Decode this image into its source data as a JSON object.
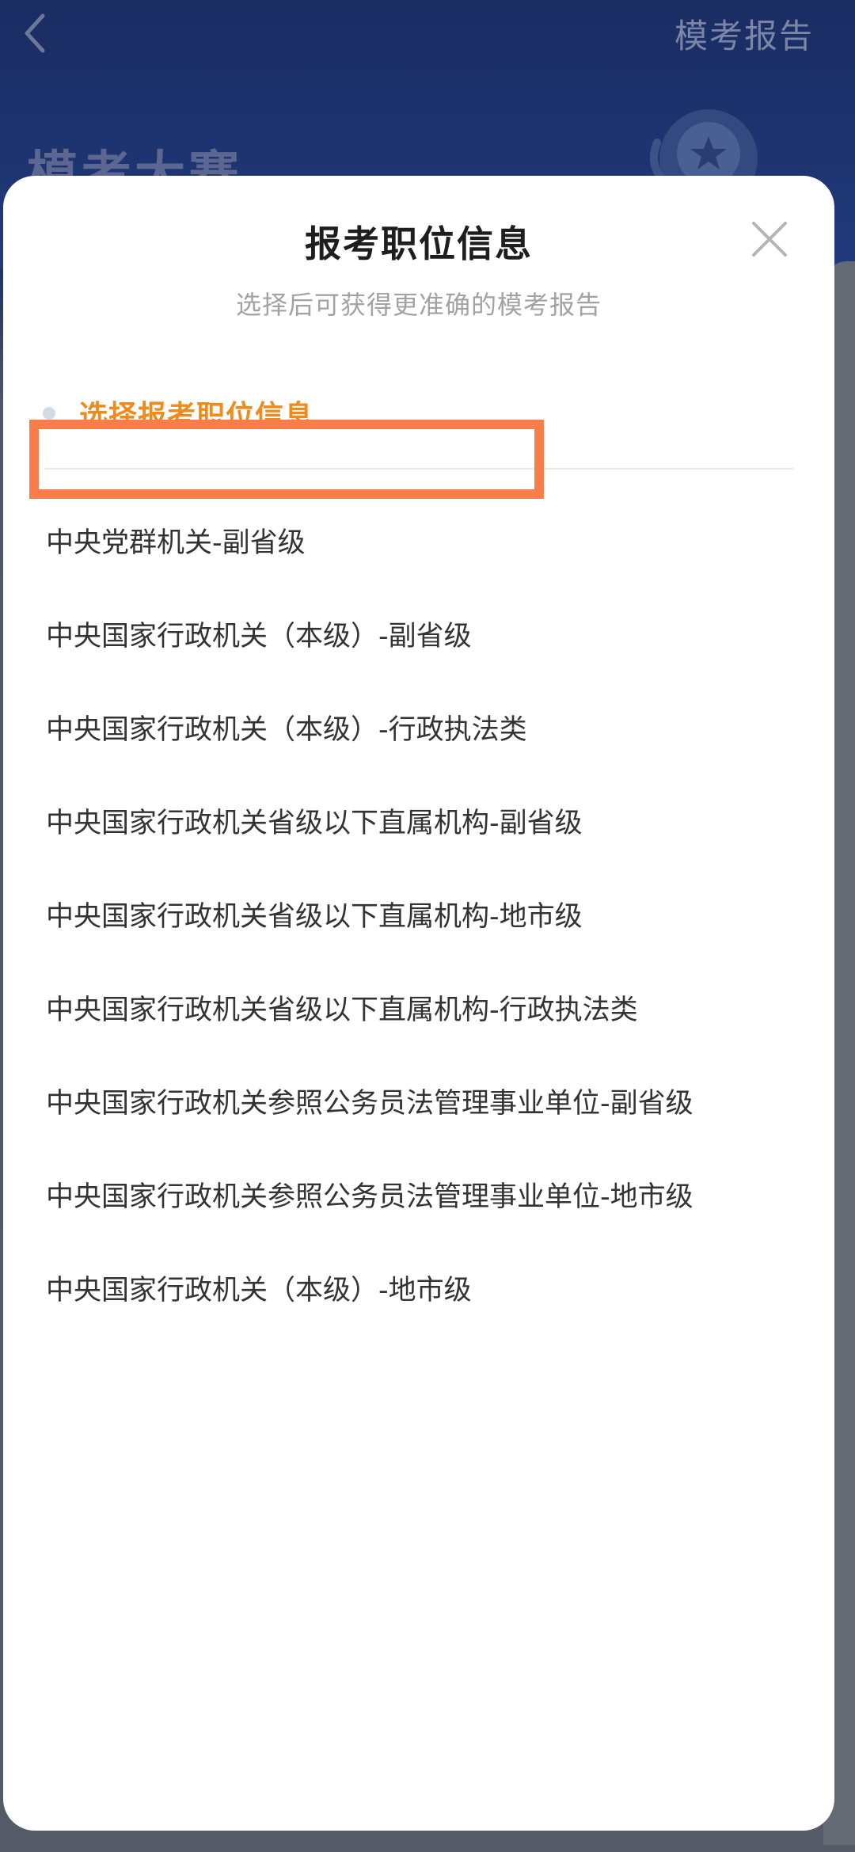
{
  "header": {
    "report_link": "模考报告",
    "title": "模考大赛"
  },
  "modal": {
    "title": "报考职位信息",
    "subtitle": "选择后可获得更准确的模考报告",
    "section_label": "选择报考职位信息",
    "options": [
      "中央党群机关-副省级",
      "中央国家行政机关（本级）-副省级",
      "中央国家行政机关（本级）-行政执法类",
      "中央国家行政机关省级以下直属机构-副省级",
      "中央国家行政机关省级以下直属机构-地市级",
      "中央国家行政机关省级以下直属机构-行政执法类",
      "中央国家行政机关参照公务员法管理事业单位-副省级",
      "中央国家行政机关参照公务员法管理事业单位-地市级",
      "中央国家行政机关（本级）-地市级"
    ]
  },
  "colors": {
    "accent_orange": "#ef8b1d",
    "highlight_border": "#f97d4a",
    "header_navy": "#1a2c62"
  },
  "icons": {
    "back": "chevron-left-icon",
    "close": "close-icon",
    "trophy": "trophy-icon"
  }
}
